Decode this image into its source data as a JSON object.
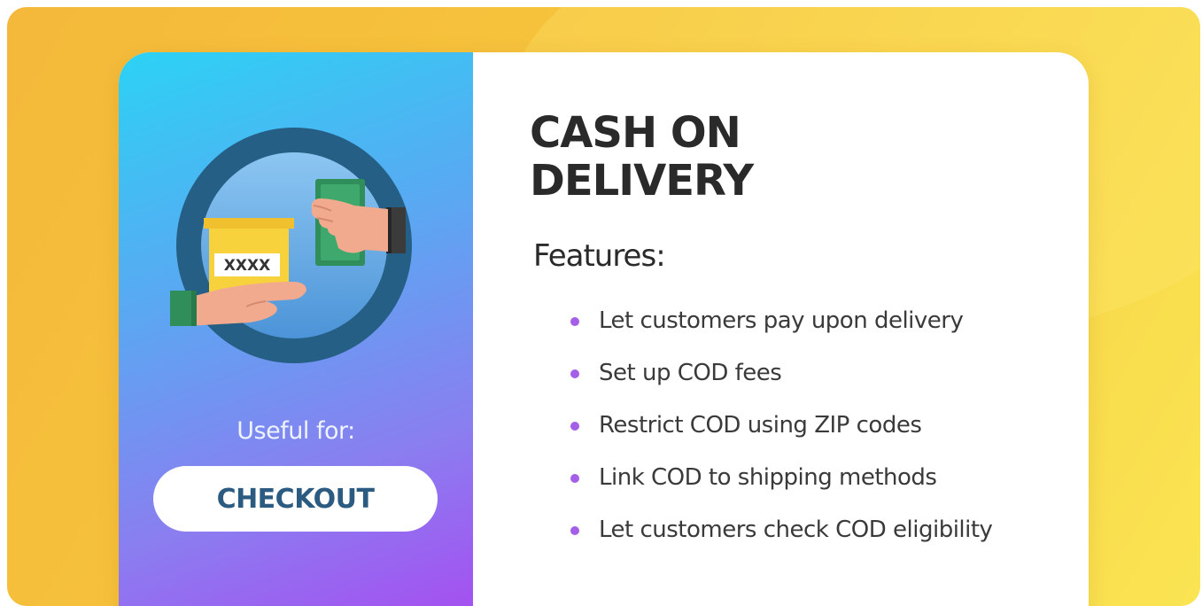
{
  "card": {
    "title_line1": "CASH ON",
    "title_line2": "DELIVERY",
    "features_heading": "Features:",
    "features": [
      "Let customers pay upon delivery",
      "Set up COD fees",
      "Restrict COD using ZIP codes",
      "Link COD to shipping methods",
      "Let customers check COD eligibility"
    ],
    "useful_for_label": "Useful for:",
    "button_label": "CHECKOUT",
    "illustration": {
      "icon": "cash-exchange-icon",
      "package_label": "XXXX"
    }
  },
  "colors": {
    "background_gradient_start": "#f4b83a",
    "background_gradient_end": "#fae452",
    "panel_gradient_start": "#2cd2f4",
    "panel_gradient_end": "#a64ef0",
    "button_text": "#2c5b82",
    "bullet": "#a45ee8",
    "title_text": "#2a2a2a"
  }
}
